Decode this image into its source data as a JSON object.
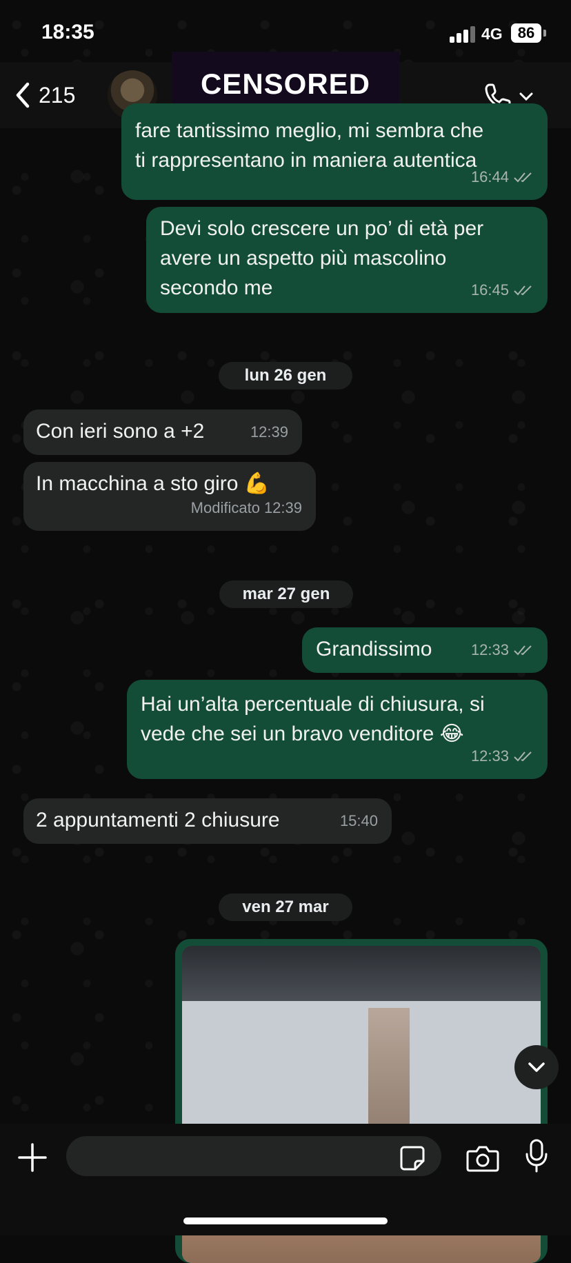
{
  "status_bar": {
    "time": "18:35",
    "network": "4G",
    "battery": "86"
  },
  "header": {
    "back_count": "215",
    "contact_name_visible": "g",
    "censor_label": "CENSORED"
  },
  "messages": [
    {
      "id": "m1",
      "direction": "out",
      "text": "fare tantissimo meglio, mi sembra che\nti rappresentano in maniera autentica",
      "time": "16:44",
      "status": "read"
    },
    {
      "id": "m2",
      "direction": "out",
      "text": "Devi solo crescere un po’ di età per\navere un aspetto più mascolino\nsecondo me",
      "time": "16:45",
      "status": "read"
    },
    {
      "id": "d1",
      "type": "date",
      "label": "lun 26 gen"
    },
    {
      "id": "m3",
      "direction": "in",
      "text": "Con ieri sono a +2",
      "time": "12:39"
    },
    {
      "id": "m4",
      "direction": "in",
      "text": "In macchina a sto giro 💪",
      "time": "12:39",
      "edited_label": "Modificato"
    },
    {
      "id": "d2",
      "type": "date",
      "label": "mar 27 gen"
    },
    {
      "id": "m5",
      "direction": "out",
      "text": "Grandissimo",
      "time": "12:33",
      "status": "read"
    },
    {
      "id": "m6",
      "direction": "out",
      "text": "Hai un’alta percentuale di chiusura, si\nvede che sei un bravo venditore 😂",
      "time": "12:33",
      "status": "read"
    },
    {
      "id": "m7",
      "direction": "in",
      "text": "2 appuntamenti 2 chiusure",
      "time": "15:40"
    },
    {
      "id": "d3",
      "type": "date",
      "label": "ven 27 mar"
    },
    {
      "id": "m8",
      "direction": "out",
      "type": "image"
    }
  ],
  "composer": {
    "placeholder": ""
  },
  "icons": {
    "back": "chevron-left-icon",
    "call": "phone-icon",
    "dropdown": "chevron-down-icon",
    "read": "double-check-icon",
    "scroll": "chevron-down-icon",
    "plus": "plus-icon",
    "sticker": "sticker-icon",
    "camera": "camera-icon",
    "mic": "microphone-icon"
  },
  "colors": {
    "outgoing_bubble": "#144d37",
    "incoming_bubble": "#242626",
    "background": "#0b0b0b"
  }
}
